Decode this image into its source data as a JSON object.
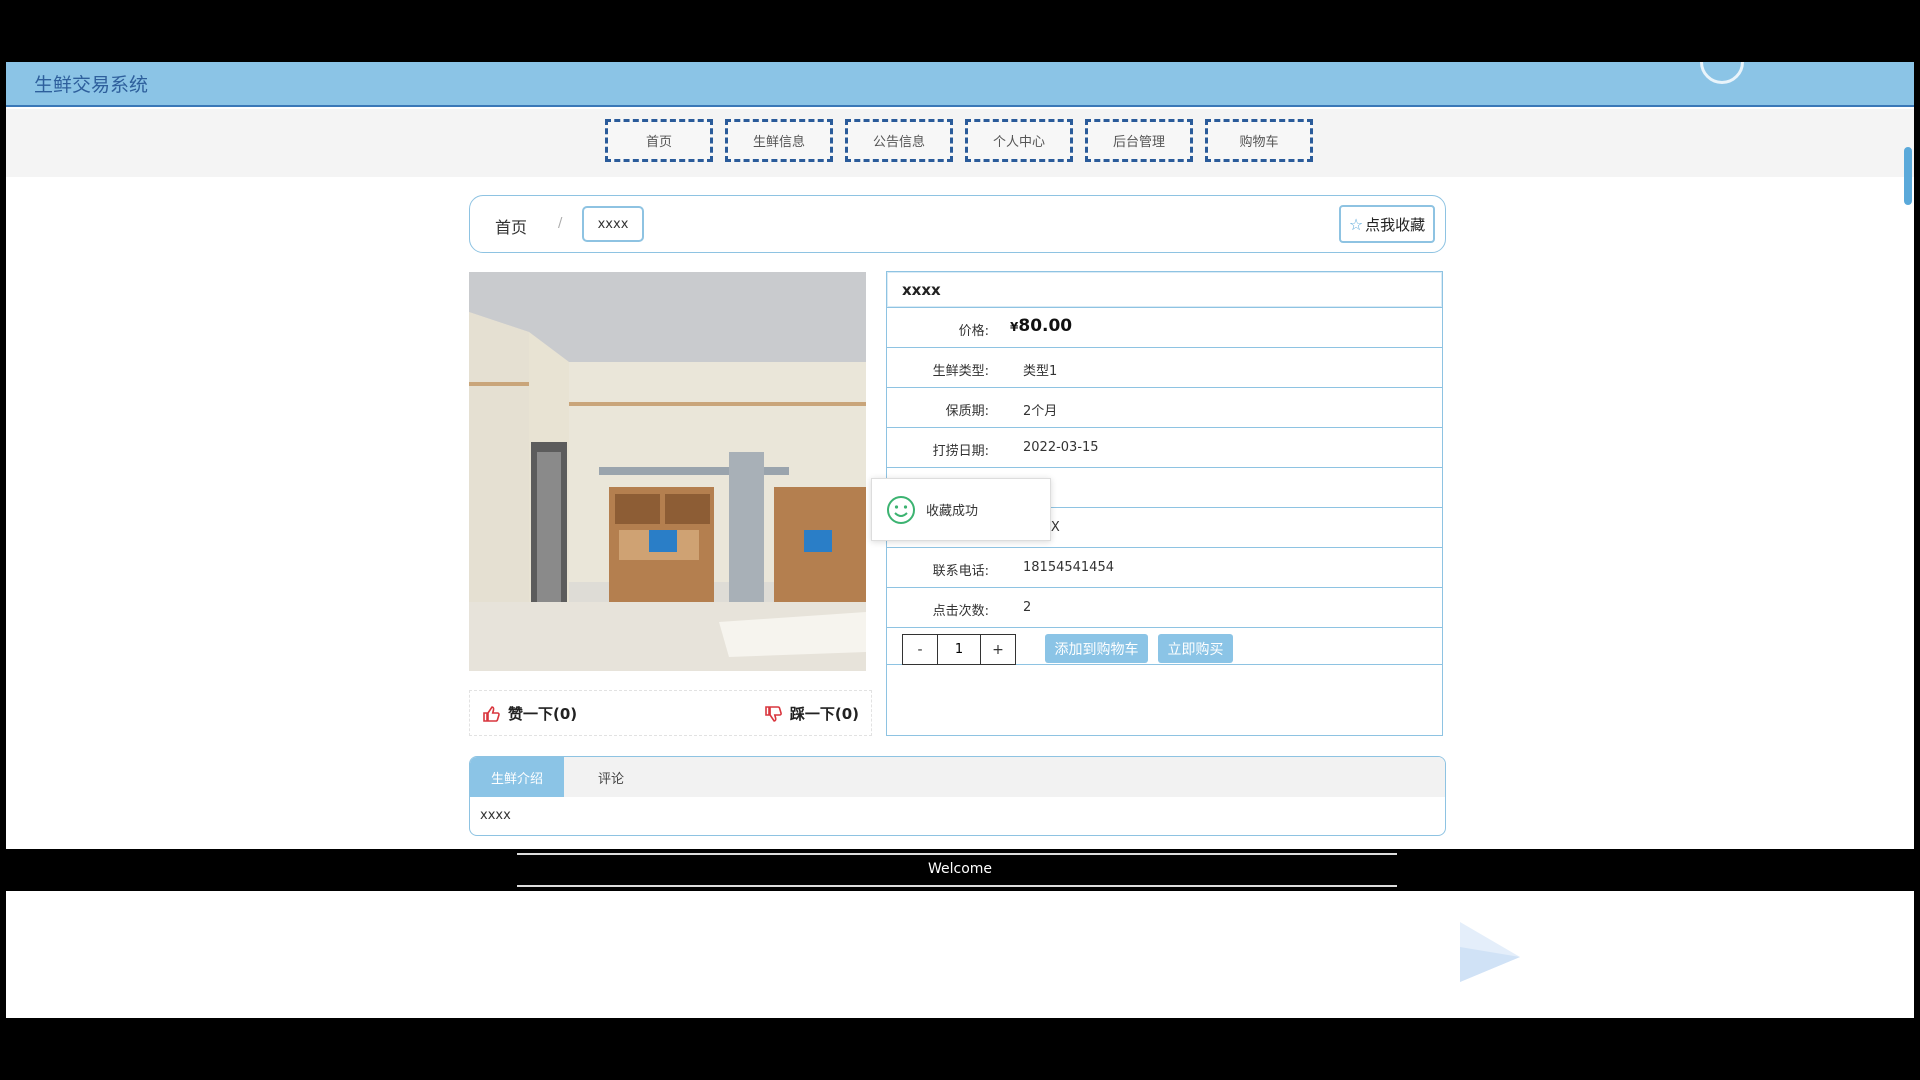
{
  "header": {
    "site_title": "生鲜交易系统"
  },
  "nav": {
    "items": [
      "首页",
      "生鲜信息",
      "公告信息",
      "个人中心",
      "后台管理",
      "购物车"
    ]
  },
  "breadcrumb": {
    "home": "首页",
    "separator": "/",
    "current": "xxxx",
    "favorite_label": "点我收藏"
  },
  "product": {
    "name": "xxxx",
    "currency": "¥",
    "price": "80.00",
    "rows": [
      {
        "label": "价格:",
        "value": "80.00"
      },
      {
        "label": "生鲜类型:",
        "value": "类型1"
      },
      {
        "label": "保质期:",
        "value": "2个月"
      },
      {
        "label": "打捞日期:",
        "value": "2022-03-15"
      },
      {
        "label": "",
        "value": ""
      },
      {
        "label": "",
        "value": "XX"
      },
      {
        "label": "联系电话:",
        "value": "18154541454"
      },
      {
        "label": "点击次数:",
        "value": "2"
      }
    ],
    "quantity": "1",
    "minus": "-",
    "plus": "+",
    "add_to_cart": "添加到购物车",
    "buy_now": "立即购买"
  },
  "vote": {
    "like": "赞一下(0)",
    "dislike": "踩一下(0)"
  },
  "toast": {
    "message": "收藏成功"
  },
  "tabs": {
    "items": [
      "生鲜介绍",
      "评论"
    ],
    "content": "xxxx"
  },
  "footer": {
    "text": "Welcome"
  },
  "colors": {
    "accent": "#8bc4e6",
    "nav_border": "#2a5b9a",
    "panel_border": "#8ec3e2"
  }
}
